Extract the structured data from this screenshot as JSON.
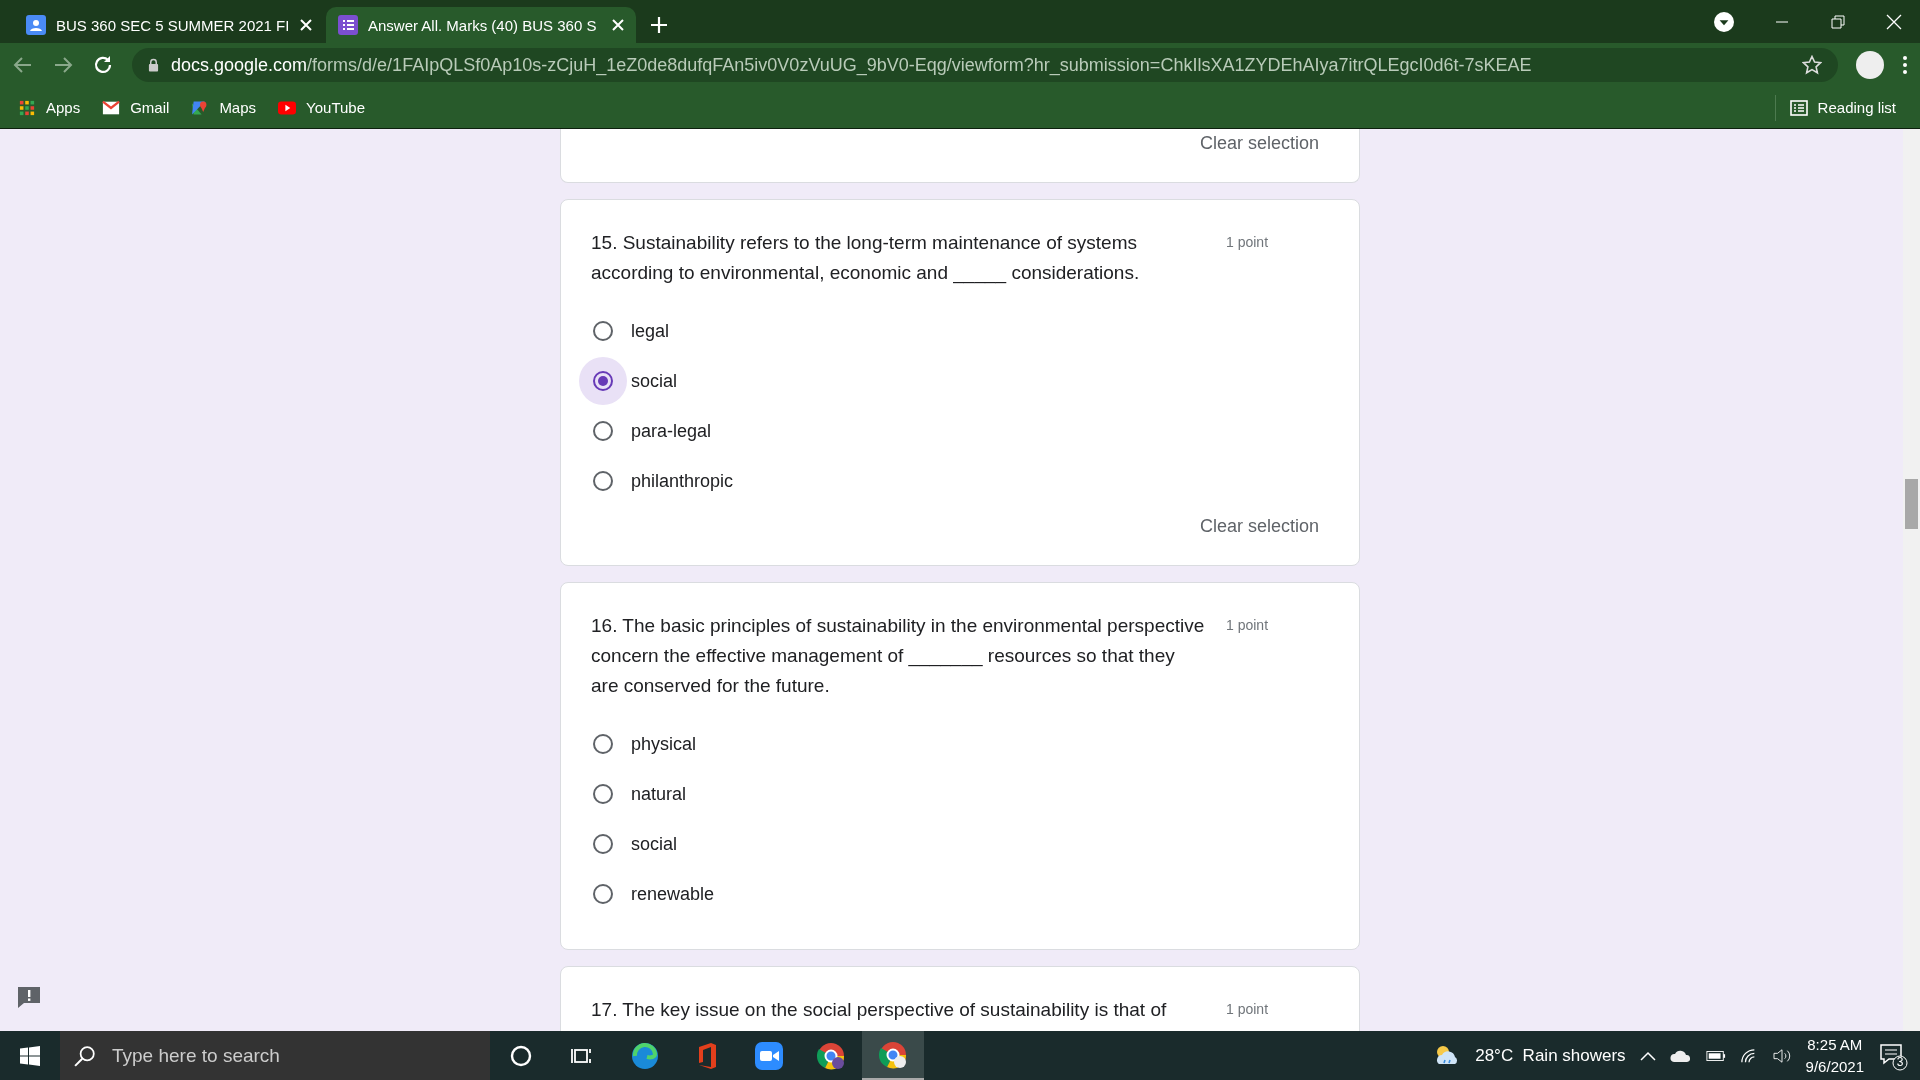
{
  "browser": {
    "tabs": [
      {
        "title": "BUS 360 SEC 5 SUMMER 2021 FI",
        "kind": "classroom",
        "selected": false
      },
      {
        "title": "Answer All. Marks (40) BUS 360 S",
        "kind": "forms",
        "selected": true
      }
    ],
    "url_host": "docs.google.com",
    "url_path": "/forms/d/e/1FAIpQLSf0Ap10s-zCjuH_1eZ0de8dufqFAn5iv0V0zVuUG_9bV0-Eqg/viewform?hr_submission=ChkIlsXA1ZYDEhAIya7itrQLEgcI0d6t-7sKEAE",
    "bookmarks": [
      {
        "label": "Apps",
        "kind": "apps"
      },
      {
        "label": "Gmail",
        "kind": "gmail"
      },
      {
        "label": "Maps",
        "kind": "maps"
      },
      {
        "label": "YouTube",
        "kind": "youtube"
      }
    ],
    "reading_list": "Reading list"
  },
  "form": {
    "previous_clear": "Clear selection",
    "questions": [
      {
        "text": "15. Sustainability refers to the long-term maintenance of systems according to environmental, economic and _____ considerations.",
        "points": "1 point",
        "options": [
          {
            "label": "legal",
            "selected": false
          },
          {
            "label": "social",
            "selected": true
          },
          {
            "label": "para-legal",
            "selected": false
          },
          {
            "label": "philanthropic",
            "selected": false
          }
        ],
        "clear": "Clear selection"
      },
      {
        "text": "16. The basic principles of sustainability in the environmental perspective concern the effective management of _______ resources so that they are conserved for the future.",
        "points": "1 point",
        "options": [
          {
            "label": "physical",
            "selected": false
          },
          {
            "label": "natural",
            "selected": false
          },
          {
            "label": "social",
            "selected": false
          },
          {
            "label": "renewable",
            "selected": false
          }
        ]
      }
    ],
    "next_question": {
      "text": "17. The key issue on the social perspective of sustainability is that of",
      "points": "1 point"
    }
  },
  "taskbar": {
    "search_placeholder": "Type here to search",
    "weather": "28°C  Rain showers",
    "time": "8:25 AM",
    "date": "9/6/2021",
    "notifications": "3"
  }
}
